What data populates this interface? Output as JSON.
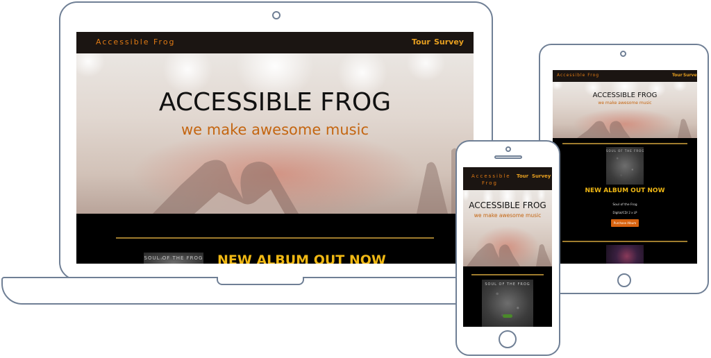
{
  "site": {
    "brand": "Accessible Frog",
    "brand_mobile_line1": "Accessible",
    "brand_mobile_line2": "Frog",
    "nav": [
      {
        "label": "Tour"
      },
      {
        "label": "Survey"
      }
    ],
    "hero_title": "ACCESSIBLE FROG",
    "hero_tagline": "we make awesome music",
    "album_heading": "NEW ALBUM OUT NOW",
    "album_cover_text": "SOUL OF THE FROG",
    "album_name": "Soul of the Frog",
    "album_formats": "Digital/CD/ 2 x LP",
    "purchase_label": "Purchase Album"
  },
  "colors": {
    "brand": "#e07a14",
    "nav_link": "#e8a020",
    "tagline": "#c46510",
    "album_heading": "#f0b814",
    "button": "#d7620f",
    "device_outline": "#6f7f95"
  },
  "icons": [
    "camera-icon",
    "home-button-icon",
    "speaker-icon"
  ]
}
